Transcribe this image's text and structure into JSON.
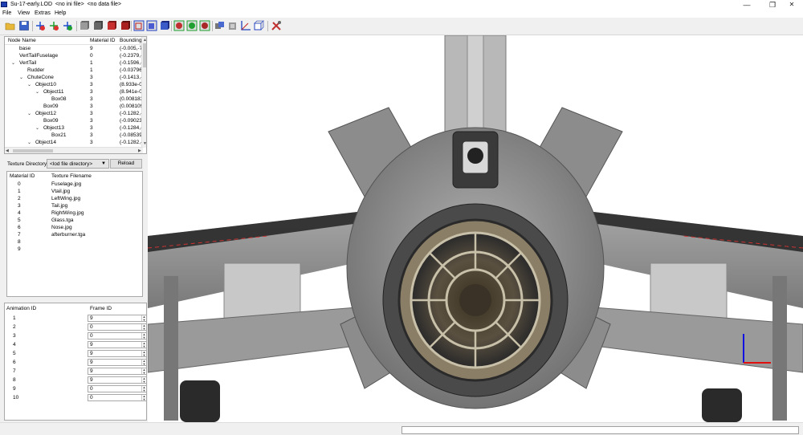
{
  "window": {
    "title": "Su-17-early.LOD  <no ini file>  <no data file>",
    "minimize": "—",
    "maximize": "❐",
    "close": "✕"
  },
  "menu": [
    "File",
    "View",
    "Extras",
    "Help"
  ],
  "toolbar": {
    "icons": [
      "open-folder-icon",
      "save-icon",
      "rotate-x-icon",
      "rotate-y-icon",
      "rotate-z-icon",
      "solid-gray-cube-icon",
      "dark-cube-icon",
      "red-cube-icon",
      "red-dark-cube-icon",
      "blue-cube-wire-icon",
      "blue-cube-solid-icon",
      "blue-cube-outline-icon",
      "green-sphere-icon",
      "green-cube-icon",
      "red-sphere-icon",
      "gray-cubes-icon",
      "gray-cube-icon",
      "axes-icon",
      "box-outline-icon",
      "tools-icon"
    ]
  },
  "node_tree": {
    "headers": [
      "Node Name",
      "Material ID",
      "Bounding"
    ],
    "rows": [
      {
        "indent": 0,
        "expander": "",
        "name": "base",
        "mat": "9",
        "bound": "(-0.005,-7"
      },
      {
        "indent": 0,
        "expander": "",
        "name": "VertTailFuselage",
        "mat": "0",
        "bound": "(-0.2379,-"
      },
      {
        "indent": 0,
        "expander": "⌄",
        "name": "VertTail",
        "mat": "1",
        "bound": "(-0.1596,-"
      },
      {
        "indent": 1,
        "expander": "",
        "name": "Rudder",
        "mat": "1",
        "bound": "(-0.03796"
      },
      {
        "indent": 1,
        "expander": "⌄",
        "name": "ChuteCone",
        "mat": "3",
        "bound": "(-0.1413,-"
      },
      {
        "indent": 2,
        "expander": "⌄",
        "name": "Object10",
        "mat": "3",
        "bound": "(8.933e-0"
      },
      {
        "indent": 3,
        "expander": "⌄",
        "name": "Object11",
        "mat": "3",
        "bound": "(8.941e-0"
      },
      {
        "indent": 4,
        "expander": "",
        "name": "Box08",
        "mat": "3",
        "bound": "(0.008183"
      },
      {
        "indent": 3,
        "expander": "",
        "name": "Box09",
        "mat": "3",
        "bound": "(0.008109"
      },
      {
        "indent": 2,
        "expander": "⌄",
        "name": "Object12",
        "mat": "3",
        "bound": "(-0.1282,-"
      },
      {
        "indent": 3,
        "expander": "",
        "name": "Box09",
        "mat": "3",
        "bound": "(-0.09023,"
      },
      {
        "indent": 3,
        "expander": "⌄",
        "name": "Object13",
        "mat": "3",
        "bound": "(-0.1284,-"
      },
      {
        "indent": 4,
        "expander": "",
        "name": "Box21",
        "mat": "3",
        "bound": "(-0.08539,"
      },
      {
        "indent": 2,
        "expander": "⌄",
        "name": "Object14",
        "mat": "3",
        "bound": "(-0.1282,-"
      }
    ]
  },
  "texture_dir": {
    "label": "Texture Directory:",
    "value": "<lod file directory>",
    "reload": "Reload"
  },
  "textures": {
    "headers": [
      "Material ID",
      "Texture Filename"
    ],
    "rows": [
      {
        "id": "0",
        "file": "Fuselage.jpg"
      },
      {
        "id": "1",
        "file": "Vtail.jpg"
      },
      {
        "id": "2",
        "file": "LeftWing.jpg"
      },
      {
        "id": "3",
        "file": "Tail.jpg"
      },
      {
        "id": "4",
        "file": "RightWing.jpg"
      },
      {
        "id": "5",
        "file": "Glass.tga"
      },
      {
        "id": "6",
        "file": "Nose.jpg"
      },
      {
        "id": "7",
        "file": "afterburner.tga"
      },
      {
        "id": "8",
        "file": ""
      },
      {
        "id": "9",
        "file": ""
      }
    ]
  },
  "animation": {
    "headers": [
      "Animation ID",
      "Frame ID"
    ],
    "rows": [
      {
        "id": "1",
        "frame": "9"
      },
      {
        "id": "2",
        "frame": "0"
      },
      {
        "id": "3",
        "frame": "0"
      },
      {
        "id": "4",
        "frame": "9"
      },
      {
        "id": "5",
        "frame": "9"
      },
      {
        "id": "6",
        "frame": "9"
      },
      {
        "id": "7",
        "frame": "9"
      },
      {
        "id": "8",
        "frame": "9"
      },
      {
        "id": "9",
        "frame": "0"
      },
      {
        "id": "10",
        "frame": "0"
      }
    ]
  },
  "colors": {
    "axis_x": "#e01010",
    "axis_y": "#1010e0",
    "aircraft_body": "#8a8a8a",
    "viewport_bg": "#ffffff"
  },
  "viewport": {
    "subject": "Su-17 aircraft rear view with engine nozzle"
  }
}
